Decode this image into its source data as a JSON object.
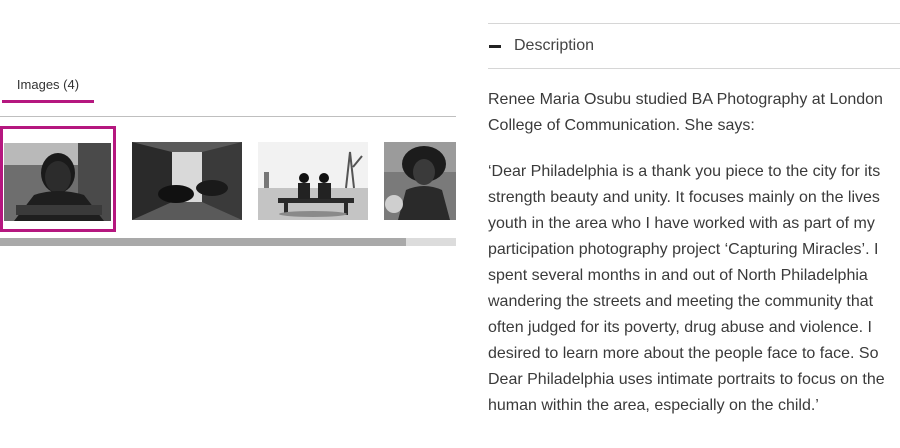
{
  "gallery": {
    "tab_label": "Images (4)",
    "thumbnails": [
      {
        "alt": "Portrait of a boy resting his chin on his arms",
        "selected": true
      },
      {
        "alt": "Children lying in a narrow alley",
        "selected": false
      },
      {
        "alt": "Two people sitting on a bench in a park",
        "selected": false
      },
      {
        "alt": "Girl with curly hair",
        "selected": false
      }
    ],
    "scroll_fraction": 0.89
  },
  "description": {
    "heading": "Description",
    "paragraph1": [
      "Renee Maria Osubu studied BA Photography at London",
      "College of Communication. She says:"
    ],
    "paragraph2": [
      "‘Dear Philadelphia is a thank you piece to the city for its",
      "strength beauty and unity. It focuses mainly on the lives",
      "youth in the area who I have worked with as part of my",
      "participation photography project ‘Capturing Miracles’. I",
      "spent several months in and out of North Philadelphia",
      "wandering the streets and meeting the community that",
      "often judged for its poverty, drug abuse and violence. I",
      "desired to learn more about the people face to face. So",
      "Dear Philadelphia uses intimate portraits to focus on the",
      "human within the area, especially on the child.’"
    ]
  },
  "colors": {
    "accent": "#b5177f",
    "text": "#3a3a3a",
    "divider": "#d6d6d6"
  },
  "icons": {
    "collapse": "minus-icon"
  }
}
